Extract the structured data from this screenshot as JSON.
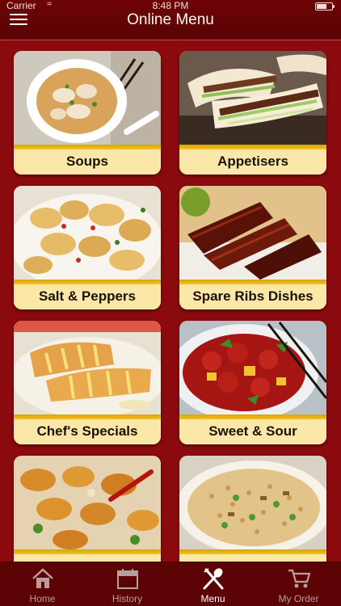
{
  "status_bar": {
    "carrier": "Carrier",
    "time": "8:48 PM"
  },
  "nav": {
    "title": "Online Menu",
    "menu_icon": "hamburger-icon"
  },
  "categories": [
    {
      "label": "Soups"
    },
    {
      "label": "Appetisers"
    },
    {
      "label": "Salt & Peppers"
    },
    {
      "label": "Spare Ribs Dishes"
    },
    {
      "label": "Chef's Specials"
    },
    {
      "label": "Sweet & Sour"
    },
    {
      "label": ""
    },
    {
      "label": ""
    }
  ],
  "tabs": [
    {
      "label": "Home",
      "icon": "home-icon",
      "active": false
    },
    {
      "label": "History",
      "icon": "calendar-icon",
      "active": false
    },
    {
      "label": "Menu",
      "icon": "fork-spoon-icon",
      "active": true
    },
    {
      "label": "My Order",
      "icon": "cart-icon",
      "active": false
    }
  ],
  "colors": {
    "background": "#8a0a0d",
    "bar": "#5c0305",
    "card_label_bg": "#fbe8a8",
    "stripe": "#e6b414"
  }
}
